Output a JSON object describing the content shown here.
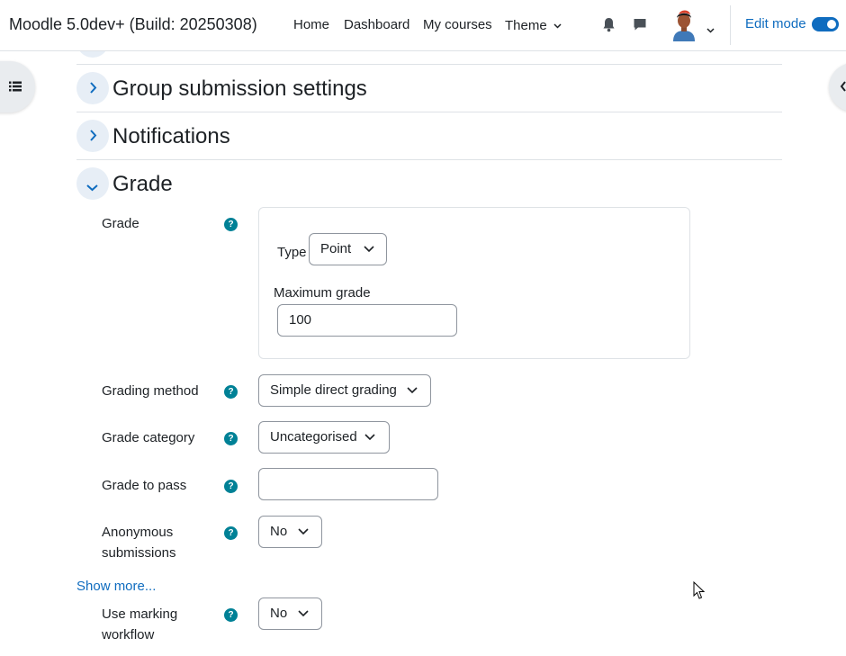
{
  "navbar": {
    "site_name": "Moodle 5.0dev+ (Build: 20250308)",
    "links": [
      "Home",
      "Dashboard",
      "My courses",
      "Theme"
    ],
    "edit_mode_label": "Edit mode",
    "edit_mode_on": true,
    "icons": [
      "bell-icon",
      "chat-icon",
      "avatar",
      "chevron-down-icon"
    ]
  },
  "sections": [
    {
      "title": "Group submission settings",
      "expanded": false
    },
    {
      "title": "Notifications",
      "expanded": false
    },
    {
      "title": "Grade",
      "expanded": true
    }
  ],
  "grade": {
    "label": "Grade",
    "type_label": "Type",
    "type_value": "Point",
    "max_grade_label": "Maximum grade",
    "max_grade_value": "100"
  },
  "fields": {
    "grading_method": {
      "label": "Grading method",
      "value": "Simple direct grading"
    },
    "grade_category": {
      "label": "Grade category",
      "value": "Uncategorised"
    },
    "grade_to_pass": {
      "label": "Grade to pass",
      "value": ""
    },
    "anonymous": {
      "label": "Anonymous submissions",
      "value": "No"
    },
    "marking_workflow": {
      "label": "Use marking workflow",
      "value": "No"
    }
  },
  "show_more_label": "Show more...",
  "colors": {
    "accent": "#0f6cbf",
    "help": "#008196",
    "border": "#8f959e"
  }
}
